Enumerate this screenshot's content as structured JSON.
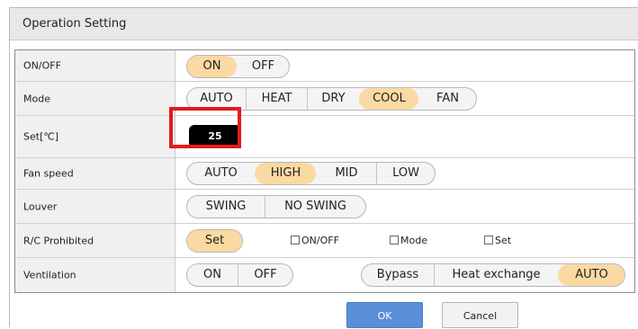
{
  "dialog": {
    "title": "Operation Setting"
  },
  "rows": {
    "onoff": {
      "label": "ON/OFF",
      "options": [
        "ON",
        "OFF"
      ],
      "selected": "ON"
    },
    "mode": {
      "label": "Mode",
      "options": [
        "AUTO",
        "HEAT",
        "DRY",
        "COOL",
        "FAN"
      ],
      "selected": "COOL"
    },
    "set": {
      "label": "Set[℃]",
      "value": "25"
    },
    "fan": {
      "label": "Fan speed",
      "options": [
        "AUTO",
        "HIGH",
        "MID",
        "LOW"
      ],
      "selected": "HIGH"
    },
    "louver": {
      "label": "Louver",
      "options": [
        "SWING",
        "NO SWING"
      ],
      "selected": ""
    },
    "rc": {
      "label": "R/C Prohibited",
      "set_label": "Set",
      "checks": [
        "ON/OFF",
        "Mode",
        "Set"
      ]
    },
    "vent": {
      "label": "Ventilation",
      "options": [
        "ON",
        "OFF"
      ],
      "options2": [
        "Bypass",
        "Heat exchange",
        "AUTO"
      ],
      "selected2": "AUTO"
    }
  },
  "buttons": {
    "ok": "OK",
    "cancel": "Cancel"
  },
  "colors": {
    "selected": "#fbd9a3",
    "highlight": "#e21b1b",
    "ok_button": "#5b8fd9"
  }
}
